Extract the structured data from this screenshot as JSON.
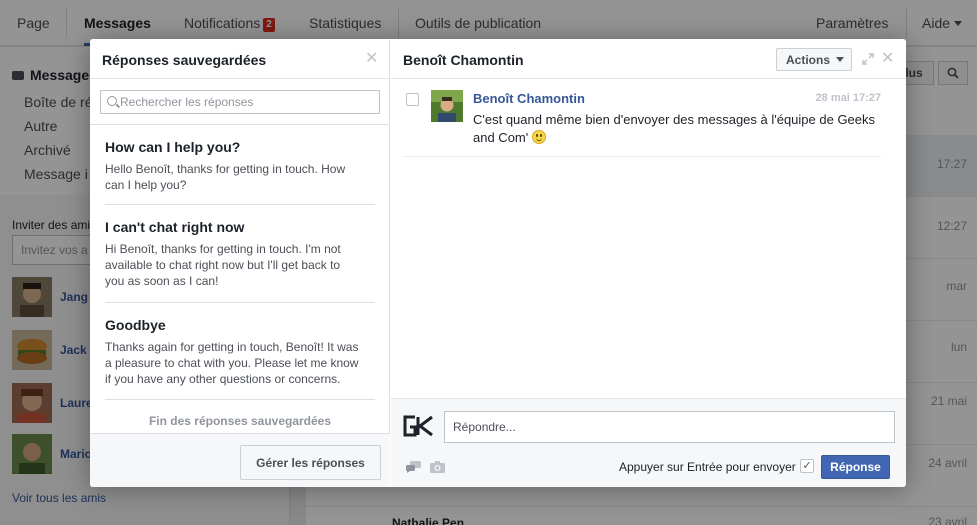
{
  "nav": {
    "tabs": [
      {
        "label": "Page"
      },
      {
        "label": "Messages"
      },
      {
        "label": "Notifications",
        "badge": "2"
      },
      {
        "label": "Statistiques"
      },
      {
        "label": "Outils de publication"
      }
    ],
    "settings": "Paramètres",
    "help": "Aide"
  },
  "left": {
    "messages_title": "Message",
    "folders": [
      "Boîte de ré",
      "Autre",
      "Archivé",
      "Message i"
    ],
    "invite_label": "Inviter des ami",
    "invite_placeholder": "Invitez vos a",
    "friends": [
      "Jang",
      "Jack",
      "Laure",
      "Mario"
    ],
    "see_all": "Voir tous les amis"
  },
  "right": {
    "toolbar_btn": "lus",
    "times": [
      "17:27",
      "12:27",
      "mar",
      "lun",
      "21 mai",
      "24 avril",
      "23 avril"
    ],
    "partial_name": "Nathalie Pen"
  },
  "saved": {
    "title": "Réponses sauvegardées",
    "search_placeholder": "Rechercher les réponses",
    "items": [
      {
        "title": "How can I help you?",
        "body": "Hello Benoît, thanks for getting in touch. How can I help you?"
      },
      {
        "title": "I can't chat right now",
        "body": "Hi Benoît, thanks for getting in touch. I'm not available to chat right now but I'll get back to you as soon as I can!"
      },
      {
        "title": "Goodbye",
        "body": "Thanks again for getting in touch, Benoît! It was a pleasure to chat with you. Please let me know if you have any other questions or concerns."
      }
    ],
    "end_text": "Fin des réponses sauvegardées",
    "manage_btn": "Gérer les réponses"
  },
  "conversation": {
    "title": "Benoît Chamontin",
    "actions_btn": "Actions",
    "message": {
      "from": "Benoît Chamontin",
      "time": "28 mai 17:27",
      "body": "C'est quand même bien d'envoyer des messages à l'équipe de Geeks and Com' "
    },
    "reply_placeholder": "Répondre...",
    "enter_label": "Appuyer sur Entrée pour envoyer",
    "send_btn": "Réponse"
  },
  "colors": {
    "accent": "#4267b2",
    "link": "#365899",
    "badge": "#e02a20"
  }
}
